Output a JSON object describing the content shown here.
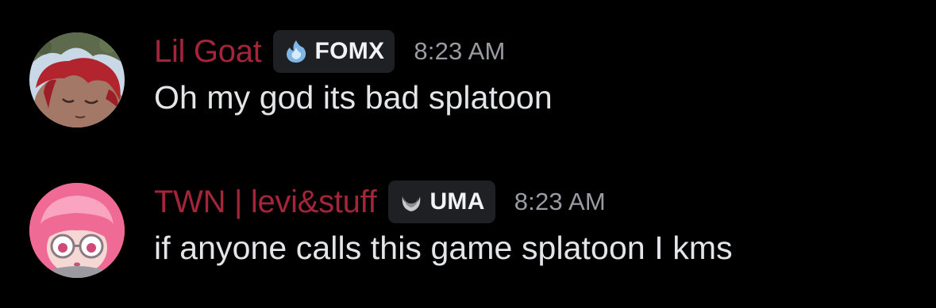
{
  "colors": {
    "background": "#000000",
    "username": "#a4253a",
    "message_text": "#e4e5e8",
    "timestamp": "#9a9ba3",
    "tag_background": "#1f2024"
  },
  "messages": [
    {
      "author": "Lil Goat",
      "avatar_icon": "avatar-red-hair-character-icon",
      "tag": {
        "label": "FOMX",
        "icon": "blue-flame-badge-icon"
      },
      "timestamp": "8:23 AM",
      "text": "Oh my god its bad splatoon"
    },
    {
      "author": "TWN | levi&stuff",
      "avatar_icon": "avatar-pink-hair-glasses-character-icon",
      "tag": {
        "label": "UMA",
        "icon": "crescent-moon-badge-icon"
      },
      "timestamp": "8:23 AM",
      "text": "if anyone calls this game splatoon I kms"
    }
  ]
}
